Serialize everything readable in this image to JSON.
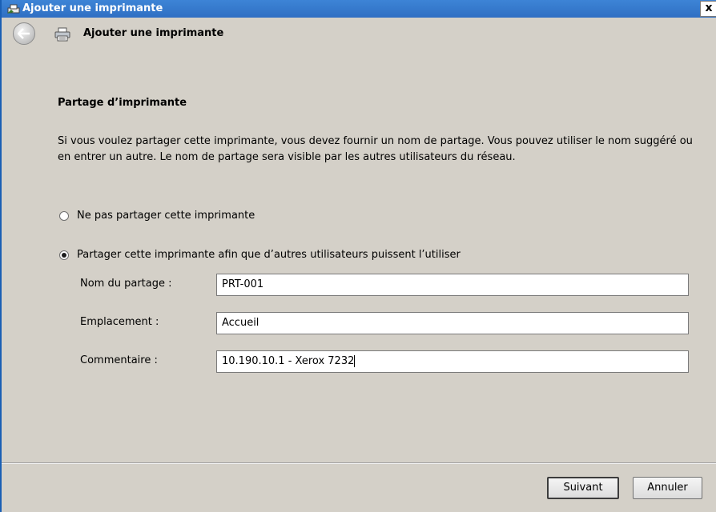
{
  "window": {
    "title": "Ajouter une imprimante",
    "close_label": "x"
  },
  "header": {
    "title": "Ajouter une imprimante"
  },
  "page": {
    "section_title": "Partage d’imprimante",
    "description": "Si vous voulez partager cette imprimante, vous devez fournir un nom de partage. Vous pouvez utiliser le nom suggéré ou en entrer un autre. Le nom de partage sera visible par les autres utilisateurs du réseau."
  },
  "options": [
    {
      "label": "Ne pas partager cette imprimante",
      "selected": false
    },
    {
      "label": "Partager cette imprimante afin que d’autres utilisateurs puissent l’utiliser",
      "selected": true
    }
  ],
  "fields": {
    "share_name": {
      "label": "Nom du partage :",
      "value": "PRT-001"
    },
    "location": {
      "label": "Emplacement :",
      "value": "Accueil"
    },
    "comment": {
      "label": "Commentaire :",
      "value": "10.190.10.1 - Xerox 7232"
    }
  },
  "buttons": {
    "next": "Suivant",
    "cancel": "Annuler"
  }
}
